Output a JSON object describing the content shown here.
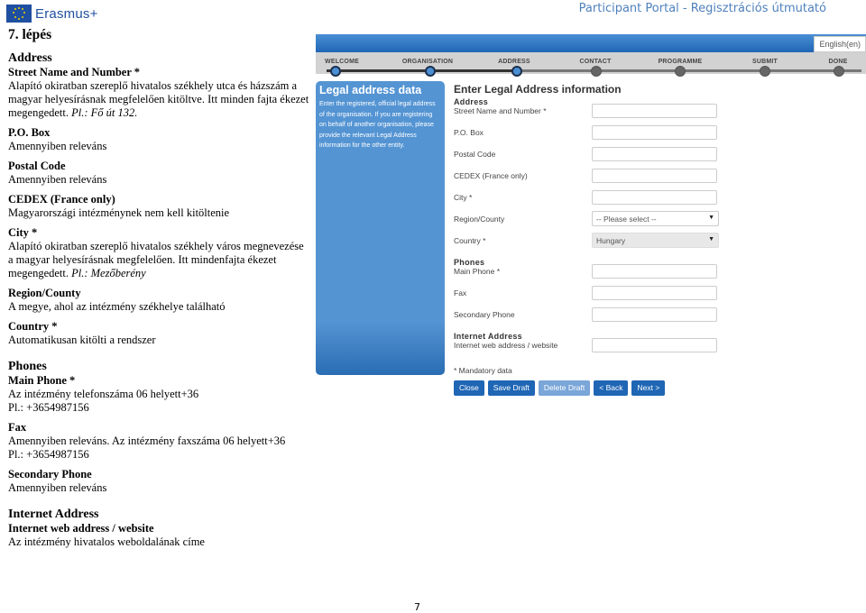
{
  "header": {
    "logo_text": "Erasmus+",
    "doc_title": "Participant Portal - Regisztrációs útmutató"
  },
  "doc": {
    "step_title": "7. lépés",
    "address_section": "Address",
    "street_title": "Street Name and Number *",
    "street_text": "Alapító okiratban szereplő hivatalos székhely utca és házszám a magyar helyesírásnak megfelelően kitöltve. Itt minden fajta ékezet megengedett. ",
    "street_example": "Pl.: Fő út 132.",
    "pobox_title": "P.O. Box",
    "pobox_text": "Amennyiben releváns",
    "postal_title": "Postal Code",
    "postal_text": "Amennyiben releváns",
    "cedex_title": "CEDEX (France only)",
    "cedex_text": "Magyarországi intézménynek nem kell kitöltenie",
    "city_title": "City *",
    "city_text": "Alapító okiratban szereplő hivatalos székhely város megnevezése a magyar helyesírásnak megfelelően. Itt mindenfajta ékezet megengedett. ",
    "city_example": "Pl.: Mezőberény",
    "region_title": "Region/County",
    "region_text": "A megye, ahol az intézmény székhelye található",
    "country_title": "Country *",
    "country_text": "Automatikusan kitölti a rendszer",
    "phones_section": "Phones",
    "main_phone_title": "Main Phone *",
    "main_phone_text1": "Az intézmény telefonszáma 06 helyett+36",
    "main_phone_text2": "Pl.: +3654987156",
    "fax_title": "Fax",
    "fax_text1": "Amennyiben releváns. Az intézmény faxszáma 06 helyett+36",
    "fax_text2": "Pl.: +3654987156",
    "secondary_title": "Secondary Phone",
    "secondary_text": "Amennyiben releváns",
    "internet_section": "Internet Address",
    "web_title": "Internet web address / website",
    "web_text": "Az intézmény hivatalos weboldalának címe"
  },
  "portal": {
    "language": "English(en)",
    "steps": [
      {
        "label": "WELCOME",
        "state": "done"
      },
      {
        "label": "ORGANISATION",
        "state": "done"
      },
      {
        "label": "ADDRESS",
        "state": "current"
      },
      {
        "label": "CONTACT",
        "state": "todo"
      },
      {
        "label": "PROGRAMME",
        "state": "todo"
      },
      {
        "label": "SUBMIT",
        "state": "todo"
      },
      {
        "label": "DONE",
        "state": "todo"
      }
    ],
    "side_title": "Legal address data",
    "side_text": "Enter the registered, official legal address of the organisation. If you are registering on behalf of another organisation, please provide the relevant Legal Address information for the other entity.",
    "form_title": "Enter Legal Address information",
    "address_group": "Address",
    "fields": {
      "street": "Street Name and Number *",
      "pobox": "P.O. Box",
      "postal": "Postal Code",
      "cedex": "CEDEX (France only)",
      "city": "City *",
      "region": "Region/County",
      "region_value": "-- Please select --",
      "country": "Country *",
      "country_value": "Hungary",
      "main_phone": "Main Phone *",
      "fax": "Fax",
      "secondary_phone": "Secondary Phone",
      "website": "Internet web address / website"
    },
    "phones_group": "Phones",
    "internet_group": "Internet Address",
    "mandatory_note": "* Mandatory data",
    "buttons": {
      "close": "Close",
      "save_draft": "Save Draft",
      "delete_draft": "Delete Draft",
      "back": "< Back",
      "next": "Next >"
    },
    "caret": "▼"
  },
  "footer": {
    "page_number": "7"
  }
}
